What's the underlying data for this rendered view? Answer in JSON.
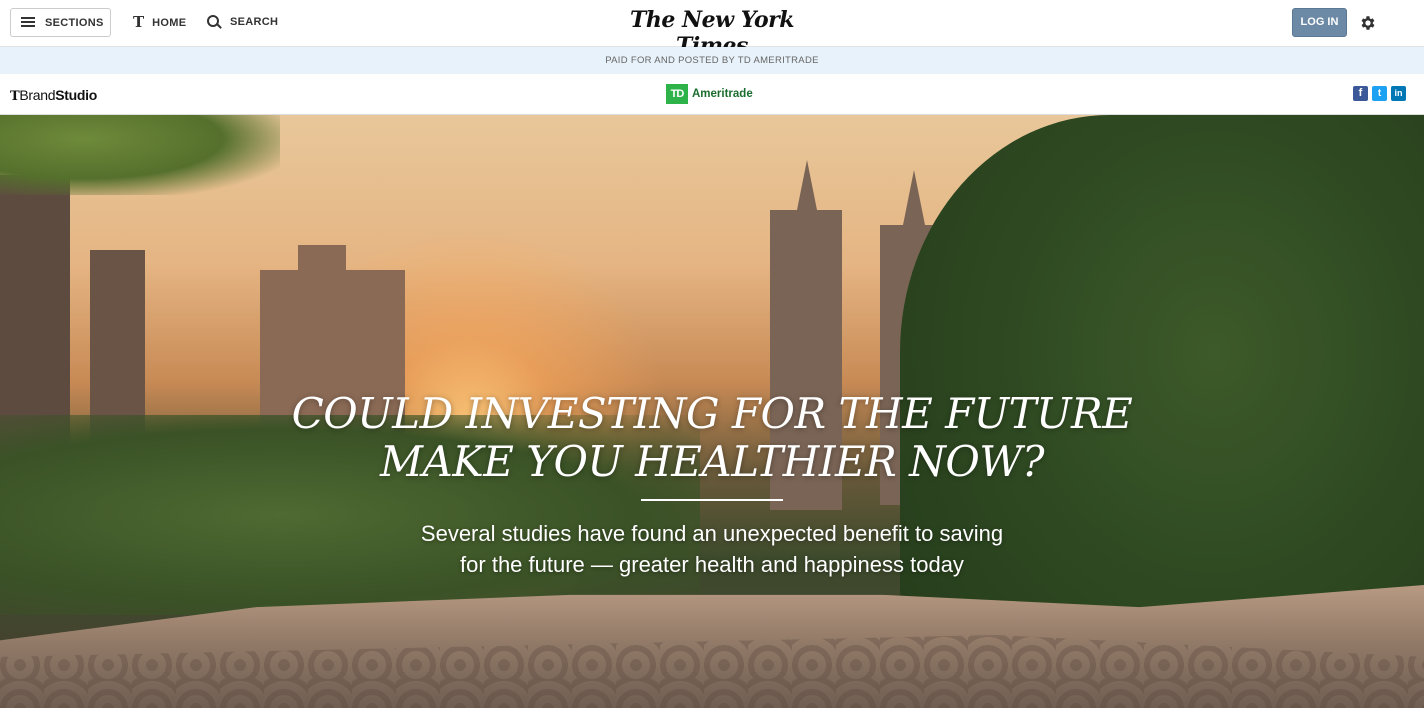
{
  "masthead": {
    "sections_label": "SECTIONS",
    "home_label": "HOME",
    "search_label": "SEARCH",
    "logo_text": "The New York Times",
    "login_label": "LOG IN",
    "home_icon_glyph": "T"
  },
  "paid_banner": {
    "text": "PAID FOR AND POSTED BY TD AMERITRADE"
  },
  "brand_bar": {
    "brand_t": "T",
    "brand_name": "Brand",
    "brand_studio": "Studio",
    "sponsor_badge": "TD",
    "sponsor_name": "Ameritrade",
    "social": {
      "facebook": "f",
      "twitter": "t",
      "linkedin": "in"
    }
  },
  "hero": {
    "headline_line1": "COULD INVESTING FOR THE FUTURE",
    "headline_line2": "MAKE YOU HEALTHIER NOW?",
    "subhead_line1": "Several studies have found an unexpected benefit to saving",
    "subhead_line2": "for the future — greater health and happiness today"
  },
  "colors": {
    "login_bg": "#6c8aa6",
    "paid_bar_bg": "#e8f2fa",
    "td_green": "#2db34a",
    "facebook": "#3b5998",
    "twitter": "#1da1f2",
    "linkedin": "#0077b5"
  },
  "icons": {
    "sections": "hamburger-icon",
    "home": "nyt-t-icon",
    "search": "search-icon",
    "settings": "gear-icon"
  }
}
